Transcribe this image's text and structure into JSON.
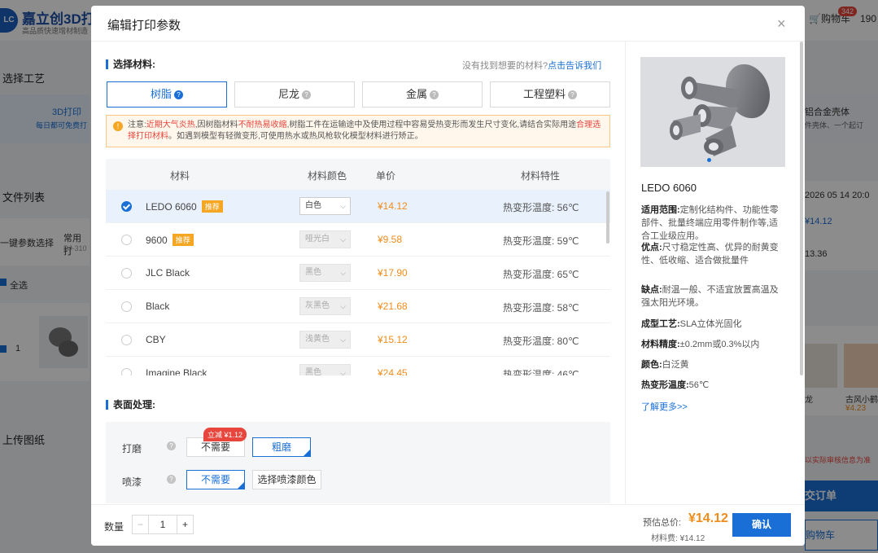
{
  "background": {
    "logo_mark": "LC",
    "logo_text": "嘉立创3D打",
    "logo_sub": "高品质快速增材制造",
    "cart_label": "购物车",
    "cart_count": "342",
    "account": "190",
    "left_sections": [
      "选择工艺",
      "文件列表",
      "一键参数选择",
      "全选",
      "上传图纸"
    ],
    "process_card_title": "3D打印",
    "process_card_sub": "每日都可免费打",
    "file_item_title": "常用打",
    "file_item_code": "BJ-310",
    "row_index": "1",
    "right_card_title": "铝合金壳体",
    "right_card_sub": "件壳体、一个起订",
    "date_text": "2026 05 14 20:0",
    "right_price": "¥14.12",
    "right_val2": "13.36",
    "thumb_label1": "龙",
    "thumb_label2": "古风小鹤",
    "thumb_price": "¥4.23",
    "bottom_note": "以实际审核信息为准",
    "submit_btn": "交订单",
    "add_cart_btn": "购物车"
  },
  "modal": {
    "title": "编辑打印参数",
    "close_glyph": "×",
    "material_section": "选择材料:",
    "help_text": "没有找到想要的材料?",
    "help_link": "点击告诉我们",
    "tabs": [
      "树脂",
      "尼龙",
      "金属",
      "工程塑料"
    ],
    "active_tab": 0,
    "notice": {
      "prefix": "注意:",
      "red1": "近期大气炎热",
      "mid1": ",因树脂材料",
      "red2": "不耐热易收缩",
      "mid2": ",树脂工件在运输途中及使用过程中容易受热变形而发生尺寸变化,请结合实际用途",
      "red3": "合理选择打印材料",
      "mid3": "。如遇到模型有轻微变形,可使用热水或热风枪软化模型材料进行矫正。"
    },
    "table_headers": [
      "材料",
      "材料颜色",
      "单价",
      "材料特性"
    ],
    "materials": [
      {
        "name": "LEDO 6060",
        "badge": "推荐",
        "color": "白色",
        "price": "¥14.12",
        "prop": "热变形温度: 56℃",
        "selected": true
      },
      {
        "name": "9600",
        "badge": "推荐",
        "color": "哑光白",
        "price": "¥9.58",
        "prop": "热变形温度: 59℃",
        "selected": false
      },
      {
        "name": "JLC Black",
        "badge": "",
        "color": "黑色",
        "price": "¥17.90",
        "prop": "热变形温度: 65℃",
        "selected": false
      },
      {
        "name": "Black",
        "badge": "",
        "color": "灰黑色",
        "price": "¥21.68",
        "prop": "热变形温度: 58℃",
        "selected": false
      },
      {
        "name": "CBY",
        "badge": "",
        "color": "浅黄色",
        "price": "¥15.12",
        "prop": "热变形温度: 80℃",
        "selected": false
      },
      {
        "name": "Imagine Black",
        "badge": "",
        "color": "黑色",
        "price": "¥24.45",
        "prop": "热变形温度: 46℃",
        "selected": false
      }
    ],
    "surface_section": "表面处理:",
    "surface": {
      "sanding_label": "打磨",
      "sanding_promo": "立减 ¥1.12",
      "sanding_options": [
        "不需要",
        "粗磨"
      ],
      "sanding_selected": 1,
      "paint_label": "喷漆",
      "paint_options": [
        "不需要",
        "选择喷漆颜色"
      ],
      "paint_selected": 0
    },
    "footer": {
      "qty_label": "数量",
      "qty_minus": "−",
      "qty_value": "1",
      "qty_plus": "+",
      "est_label": "预估总价:",
      "est_value": "¥14.12",
      "material_fee_label": "材料费:",
      "material_fee_value": "¥14.12",
      "confirm": "确认"
    },
    "product": {
      "name": "LEDO 6060",
      "details": [
        {
          "k": "适用范围:",
          "v": "定制化结构件、功能性零部件、批量终端应用零件制作等,适合工业级应用。"
        },
        {
          "k": "优点:",
          "v": "尺寸稳定性高、优异的耐黄变性、低收缩、适合做批量件"
        },
        {
          "k": "缺点:",
          "v": "耐温一般、不适宜放置高温及强太阳光环境。"
        },
        {
          "k": "成型工艺:",
          "v": "SLA立体光固化"
        },
        {
          "k": "材料精度:",
          "v": "±0.2mm或0.3%以内"
        },
        {
          "k": "颜色:",
          "v": "白泛黄"
        },
        {
          "k": "热变形温度:",
          "v": "56℃"
        }
      ],
      "more_link": "了解更多>>"
    }
  }
}
